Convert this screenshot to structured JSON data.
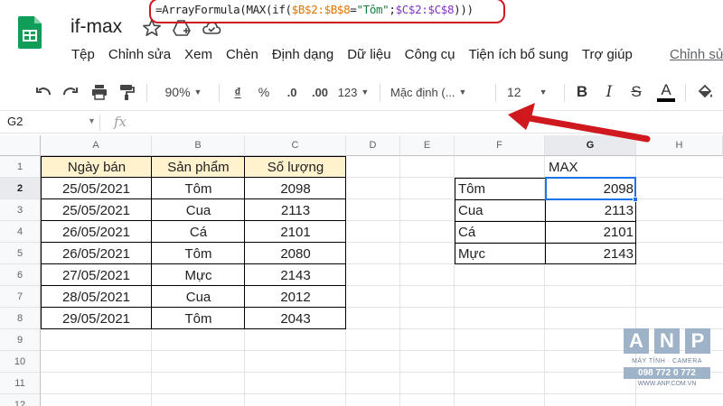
{
  "title": "if-max",
  "menu": [
    "Tệp",
    "Chỉnh sửa",
    "Xem",
    "Chèn",
    "Định dạng",
    "Dữ liệu",
    "Công cụ",
    "Tiện ích bổ sung",
    "Trợ giúp"
  ],
  "last_edit": "Chỉnh sửa",
  "toolbar": {
    "zoom": "90%",
    "currency": "₫",
    "percent": "%",
    "dec_decrease": ".0",
    "dec_increase": ".00",
    "more_formats": "123",
    "font": "Mặc định (...",
    "font_size": "12",
    "bold": "B",
    "italic": "I",
    "strike": "S",
    "text_color_letter": "A",
    "text_color": "#000000"
  },
  "formula_bar": {
    "cell_ref": "G2",
    "fx": "fx",
    "formula_parts": [
      "=ArrayFormula(MAX(if(",
      "$B$2:$B$8",
      "=",
      "\"Tôm\"",
      ";",
      "$C$2:$C$8",
      ")))"
    ]
  },
  "columns": [
    "A",
    "B",
    "C",
    "D",
    "E",
    "F",
    "G",
    "H"
  ],
  "rows": [
    "1",
    "2",
    "3",
    "4",
    "5",
    "6",
    "7",
    "8",
    "9",
    "10",
    "11",
    "12"
  ],
  "table": {
    "headers": [
      "Ngày bán",
      "Sản phẩm",
      "Số lượng"
    ],
    "rows": [
      [
        "25/05/2021",
        "Tôm",
        "2098"
      ],
      [
        "25/05/2021",
        "Cua",
        "2113"
      ],
      [
        "26/05/2021",
        "Cá",
        "2101"
      ],
      [
        "26/05/2021",
        "Tôm",
        "2080"
      ],
      [
        "27/05/2021",
        "Mực",
        "2143"
      ],
      [
        "28/05/2021",
        "Cua",
        "2012"
      ],
      [
        "29/05/2021",
        "Tôm",
        "2043"
      ]
    ]
  },
  "lookup": {
    "header": "MAX",
    "rows": [
      [
        "Tôm",
        "2098"
      ],
      [
        "Cua",
        "2113"
      ],
      [
        "Cá",
        "2101"
      ],
      [
        "Mực",
        "2143"
      ]
    ]
  },
  "watermark": {
    "letters": [
      "A",
      "N",
      "P"
    ],
    "subtitle": "MÁY TÍNH · CAMERA",
    "phone": "098 772 0 772",
    "url": "WWW.ANP.COM.VN"
  },
  "colors": {
    "header_fill": "#fff2cc",
    "annotation_red": "#d0191f",
    "selection_blue": "#1a73e8",
    "sheets_green": "#0f9d58"
  }
}
